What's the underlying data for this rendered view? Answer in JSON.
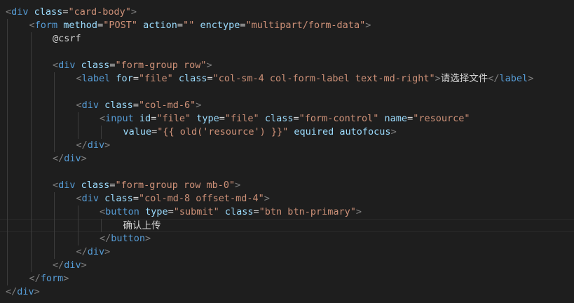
{
  "editor": {
    "lines": [
      {
        "indent": 0,
        "tokens": [
          [
            "p",
            "<"
          ],
          [
            "t",
            "div"
          ],
          [
            "x",
            " "
          ],
          [
            "a",
            "class"
          ],
          [
            "x",
            "="
          ],
          [
            "s",
            "\"card-body\""
          ],
          [
            "p",
            ">"
          ]
        ]
      },
      {
        "indent": 1,
        "tokens": [
          [
            "p",
            "<"
          ],
          [
            "t",
            "form"
          ],
          [
            "x",
            " "
          ],
          [
            "a",
            "method"
          ],
          [
            "x",
            "="
          ],
          [
            "s",
            "\"POST\""
          ],
          [
            "x",
            " "
          ],
          [
            "a",
            "action"
          ],
          [
            "x",
            "="
          ],
          [
            "s",
            "\"\""
          ],
          [
            "x",
            " "
          ],
          [
            "a",
            "enctype"
          ],
          [
            "x",
            "="
          ],
          [
            "s",
            "\"multipart/form-data\""
          ],
          [
            "p",
            ">"
          ]
        ]
      },
      {
        "indent": 2,
        "tokens": [
          [
            "x",
            "@csrf"
          ]
        ]
      },
      {
        "indent": 0,
        "tokens": []
      },
      {
        "indent": 2,
        "tokens": [
          [
            "p",
            "<"
          ],
          [
            "t",
            "div"
          ],
          [
            "x",
            " "
          ],
          [
            "a",
            "class"
          ],
          [
            "x",
            "="
          ],
          [
            "s",
            "\"form-group row\""
          ],
          [
            "p",
            ">"
          ]
        ]
      },
      {
        "indent": 3,
        "tokens": [
          [
            "p",
            "<"
          ],
          [
            "t",
            "label"
          ],
          [
            "x",
            " "
          ],
          [
            "a",
            "for"
          ],
          [
            "x",
            "="
          ],
          [
            "s",
            "\"file\""
          ],
          [
            "x",
            " "
          ],
          [
            "a",
            "class"
          ],
          [
            "x",
            "="
          ],
          [
            "s",
            "\"col-sm-4 col-form-label text-md-right\""
          ],
          [
            "p",
            ">"
          ],
          [
            "cn",
            "请选择文件"
          ],
          [
            "p",
            "</"
          ],
          [
            "t",
            "label"
          ],
          [
            "p",
            ">"
          ]
        ]
      },
      {
        "indent": 0,
        "tokens": []
      },
      {
        "indent": 3,
        "tokens": [
          [
            "p",
            "<"
          ],
          [
            "t",
            "div"
          ],
          [
            "x",
            " "
          ],
          [
            "a",
            "class"
          ],
          [
            "x",
            "="
          ],
          [
            "s",
            "\"col-md-6\""
          ],
          [
            "p",
            ">"
          ]
        ]
      },
      {
        "indent": 4,
        "tokens": [
          [
            "p",
            "<"
          ],
          [
            "t",
            "input"
          ],
          [
            "x",
            " "
          ],
          [
            "a",
            "id"
          ],
          [
            "x",
            "="
          ],
          [
            "s",
            "\"file\""
          ],
          [
            "x",
            " "
          ],
          [
            "a",
            "type"
          ],
          [
            "x",
            "="
          ],
          [
            "s",
            "\"file\""
          ],
          [
            "x",
            " "
          ],
          [
            "a",
            "class"
          ],
          [
            "x",
            "="
          ],
          [
            "s",
            "\"form-control\""
          ],
          [
            "x",
            " "
          ],
          [
            "a",
            "name"
          ],
          [
            "x",
            "="
          ],
          [
            "s",
            "\"resource\""
          ]
        ]
      },
      {
        "indent": 5,
        "tokens": [
          [
            "a",
            "value"
          ],
          [
            "x",
            "="
          ],
          [
            "s",
            "\"{{ old('resource') }}\""
          ],
          [
            "x",
            " "
          ],
          [
            "a",
            "equired"
          ],
          [
            "x",
            " "
          ],
          [
            "a",
            "autofocus"
          ],
          [
            "p",
            ">"
          ]
        ]
      },
      {
        "indent": 3,
        "tokens": [
          [
            "p",
            "</"
          ],
          [
            "t",
            "div"
          ],
          [
            "p",
            ">"
          ]
        ]
      },
      {
        "indent": 2,
        "tokens": [
          [
            "p",
            "</"
          ],
          [
            "t",
            "div"
          ],
          [
            "p",
            ">"
          ]
        ]
      },
      {
        "indent": 0,
        "tokens": []
      },
      {
        "indent": 2,
        "tokens": [
          [
            "p",
            "<"
          ],
          [
            "t",
            "div"
          ],
          [
            "x",
            " "
          ],
          [
            "a",
            "class"
          ],
          [
            "x",
            "="
          ],
          [
            "s",
            "\"form-group row mb-0\""
          ],
          [
            "p",
            ">"
          ]
        ]
      },
      {
        "indent": 3,
        "tokens": [
          [
            "p",
            "<"
          ],
          [
            "t",
            "div"
          ],
          [
            "x",
            " "
          ],
          [
            "a",
            "class"
          ],
          [
            "x",
            "="
          ],
          [
            "s",
            "\"col-md-8 offset-md-4\""
          ],
          [
            "p",
            ">"
          ]
        ]
      },
      {
        "indent": 4,
        "tokens": [
          [
            "p",
            "<"
          ],
          [
            "t",
            "button"
          ],
          [
            "x",
            " "
          ],
          [
            "a",
            "type"
          ],
          [
            "x",
            "="
          ],
          [
            "s",
            "\"submit\""
          ],
          [
            "x",
            " "
          ],
          [
            "a",
            "class"
          ],
          [
            "x",
            "="
          ],
          [
            "s",
            "\"btn btn-primary\""
          ],
          [
            "p",
            ">"
          ]
        ]
      },
      {
        "indent": 5,
        "tokens": [
          [
            "cn",
            "确认上传"
          ]
        ],
        "current": true
      },
      {
        "indent": 4,
        "tokens": [
          [
            "p",
            "</"
          ],
          [
            "t",
            "button"
          ],
          [
            "p",
            ">"
          ]
        ]
      },
      {
        "indent": 3,
        "tokens": [
          [
            "p",
            "</"
          ],
          [
            "t",
            "div"
          ],
          [
            "p",
            ">"
          ]
        ]
      },
      {
        "indent": 2,
        "tokens": [
          [
            "p",
            "</"
          ],
          [
            "t",
            "div"
          ],
          [
            "p",
            ">"
          ]
        ]
      },
      {
        "indent": 1,
        "tokens": [
          [
            "p",
            "</"
          ],
          [
            "t",
            "form"
          ],
          [
            "p",
            ">"
          ]
        ]
      },
      {
        "indent": 0,
        "tokens": [
          [
            "p",
            "</"
          ],
          [
            "t",
            "div"
          ],
          [
            "p",
            ">"
          ]
        ]
      }
    ]
  }
}
